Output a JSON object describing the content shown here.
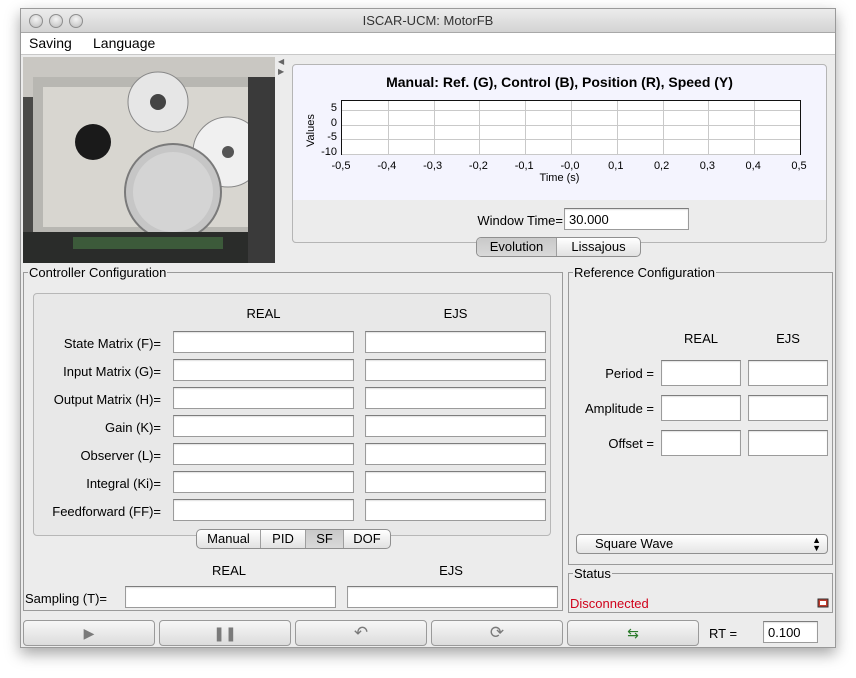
{
  "window": {
    "title": "ISCAR-UCM: MotorFB"
  },
  "menu": {
    "items": [
      "Saving",
      "Language"
    ]
  },
  "plot": {
    "title": "Manual: Ref. (G), Control (B), Position (R), Speed (Y)",
    "window_time_label": "Window Time=",
    "window_time_value": "30.000",
    "tabs": [
      "Evolution",
      "Lissajous"
    ],
    "active_tab": "Evolution"
  },
  "chart_data": {
    "type": "line",
    "title": "Manual: Ref. (G), Control (B), Position (R), Speed (Y)",
    "xlabel": "Time (s)",
    "ylabel": "Values",
    "x_ticks": [
      "-0,5",
      "-0,4",
      "-0,3",
      "-0,2",
      "-0,1",
      "-0,0",
      "0,1",
      "0,2",
      "0,3",
      "0,4",
      "0,5"
    ],
    "y_ticks": [
      "5",
      "0",
      "-5",
      "-10"
    ],
    "xlim": [
      -0.5,
      0.5
    ],
    "ylim": [
      -10,
      8
    ],
    "grid": true,
    "series": []
  },
  "controller": {
    "legend": "Controller Configuration",
    "col_real": "REAL",
    "col_ejs": "EJS",
    "rows": [
      {
        "label": "State Matrix (F)=",
        "real": "",
        "ejs": ""
      },
      {
        "label": "Input Matrix (G)=",
        "real": "",
        "ejs": ""
      },
      {
        "label": "Output Matrix (H)=",
        "real": "",
        "ejs": ""
      },
      {
        "label": "Gain (K)=",
        "real": "",
        "ejs": ""
      },
      {
        "label": "Observer (L)=",
        "real": "",
        "ejs": ""
      },
      {
        "label": "Integral (Ki)=",
        "real": "",
        "ejs": ""
      },
      {
        "label": "Feedforward (FF)=",
        "real": "",
        "ejs": ""
      }
    ],
    "modes": [
      "Manual",
      "PID",
      "SF",
      "DOF"
    ],
    "active_mode": "SF",
    "sampling_real_header": "REAL",
    "sampling_ejs_header": "EJS",
    "sampling_label": "Sampling  (T)=",
    "sampling_real": "",
    "sampling_ejs": ""
  },
  "reference": {
    "legend": "Reference Configuration",
    "col_real": "REAL",
    "col_ejs": "EJS",
    "rows": [
      {
        "label": "Period =",
        "real": "",
        "ejs": ""
      },
      {
        "label": "Amplitude =",
        "real": "",
        "ejs": ""
      },
      {
        "label": "Offset =",
        "real": "",
        "ejs": ""
      }
    ],
    "waveform": "Square Wave"
  },
  "status": {
    "legend": "Status",
    "text": "Disconnected",
    "color": "#d0021b"
  },
  "toolbar": {
    "buttons": [
      "play-icon",
      "pause-icon",
      "reset-icon",
      "refresh-icon",
      "connect-icon"
    ],
    "rt_label": "RT =",
    "rt_value": "0.100"
  }
}
